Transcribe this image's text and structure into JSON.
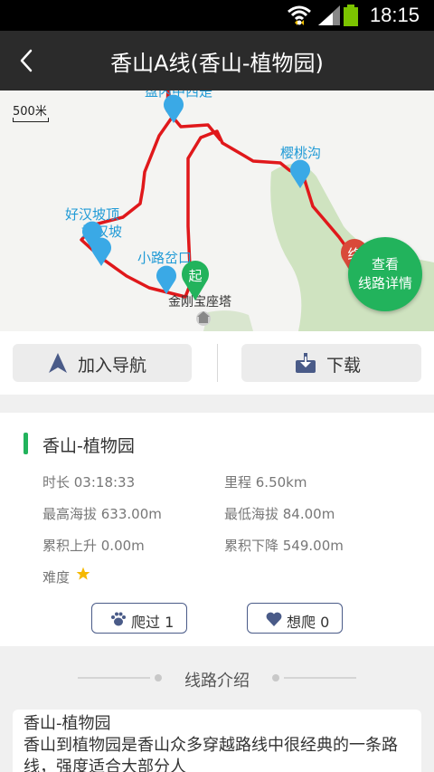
{
  "status_bar": {
    "time": "18:15"
  },
  "app_bar": {
    "title": "香山A线(香山-植物园)"
  },
  "map": {
    "scale_label": "500米",
    "labels": {
      "top_partial": "盘内中西是",
      "cherry": "樱桃沟",
      "haohanpo": "好汉坡顶",
      "haohanpo2": "好汉坡",
      "xiaolu": "小路岔口",
      "pagoda": "金刚宝座塔",
      "start_marker": "起",
      "end_marker": "终"
    },
    "detail_button": {
      "line1": "查看",
      "line2": "线路详情"
    },
    "colors": {
      "route": "#e0181b",
      "marker": "#3aa9e6",
      "start": "#22b35c",
      "end": "#d94a3a",
      "park": "#cfe3c0"
    }
  },
  "actions": {
    "navigate_label": "加入导航",
    "download_label": "下载"
  },
  "info": {
    "route_name": "香山-植物园",
    "duration_label": "时长 03:18:33",
    "distance_label": "里程 6.50km",
    "max_alt_label": "最高海拔 633.00m",
    "min_alt_label": "最低海拔 84.00m",
    "ascent_label": "累积上升 0.00m",
    "descent_label": "累积下降 549.00m",
    "difficulty_label": "难度",
    "difficulty_stars": 1,
    "climbed_label": "爬过 1",
    "want_label": "想爬 0"
  },
  "section": {
    "title": "线路介绍"
  },
  "intro": {
    "title": "香山-植物园",
    "body": "香山到植物园是香山众多穿越路线中很经典的一条路线，强度适合大部分人"
  }
}
